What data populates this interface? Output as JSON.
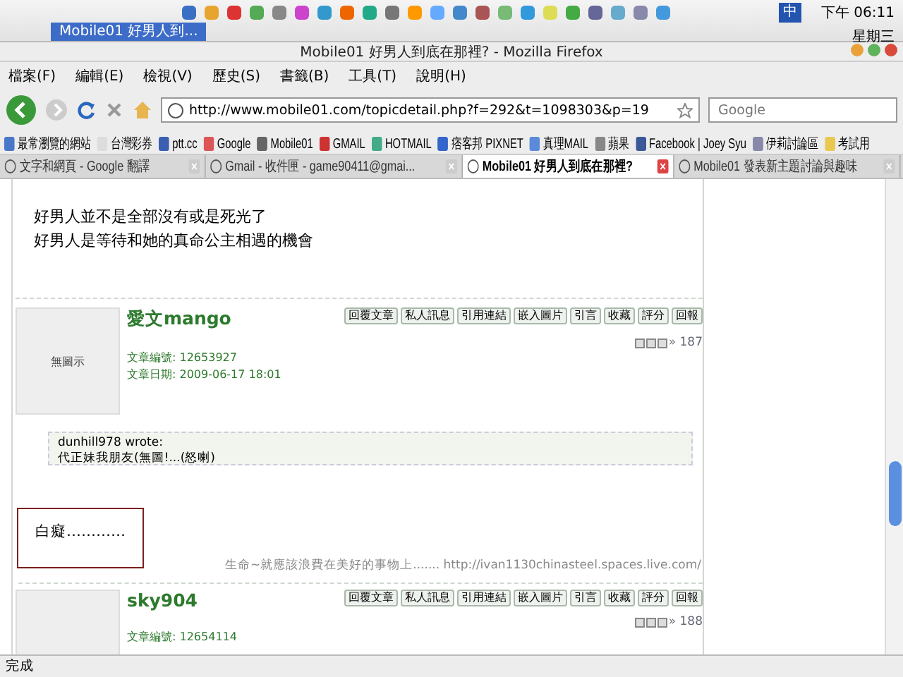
{
  "panel": {
    "taskbar_button": "Mobile01 好男人到...",
    "input_method": "中",
    "time": "下午 06:11",
    "weekday": "星期三"
  },
  "window": {
    "title": "Mobile01 好男人到底在那裡? - Mozilla Firefox"
  },
  "menu": [
    "檔案(F)",
    "編輯(E)",
    "檢視(V)",
    "歷史(S)",
    "書籤(B)",
    "工具(T)",
    "說明(H)"
  ],
  "address": {
    "value": "http://www.mobile01.com/topicdetail.php?f=292&t=1098303&p=19"
  },
  "search": {
    "placeholder": "Google"
  },
  "bookmarks": [
    "最常瀏覽的網站",
    "台灣彩券",
    "ptt.cc",
    "Google",
    "Mobile01",
    "GMAIL",
    "HOTMAIL",
    "痞客邦 PIXNET",
    "真理MAIL",
    "蘋果",
    "Facebook | Joey Syu",
    "伊莉討論區",
    "考試用"
  ],
  "tabs": [
    {
      "label": "文字和網頁 - Google 翻譯",
      "selected": false
    },
    {
      "label": "Gmail - 收件匣 - game90411@gmai...",
      "selected": false
    },
    {
      "label": "Mobile01 好男人到底在那裡?",
      "selected": true
    },
    {
      "label": "Mobile01 發表新主題討論與趣味",
      "selected": false
    }
  ],
  "post_text": [
    "好男人並不是全部沒有或是死光了",
    "好男人是等待和她的真命公主相遇的機會"
  ],
  "posts": [
    {
      "author": "愛文mango",
      "avatar": "無圖示",
      "id_label": "文章編號:",
      "id": "12653927",
      "date_label": "文章日期:",
      "date": "2009-06-17 18:01",
      "actions": [
        "回覆文章",
        "私人訊息",
        "引用連結",
        "嵌入圖片",
        "引言",
        "收藏",
        "評分",
        "回報"
      ],
      "floor": "» 187",
      "quote_author": "dunhill978 wrote:",
      "quote": "代正妹我朋友(無圖!...(怒喇)",
      "reply": "白癡…………",
      "signature": "生命~就應該浪費在美好的事物上....... http://ivan1130chinasteel.spaces.live.com/"
    },
    {
      "author": "sky904",
      "id_label": "文章編號:",
      "id": "12654114",
      "actions": [
        "回覆文章",
        "私人訊息",
        "引用連結",
        "嵌入圖片",
        "引言",
        "收藏",
        "評分",
        "回報"
      ],
      "floor": "» 188"
    }
  ],
  "status": "完成"
}
